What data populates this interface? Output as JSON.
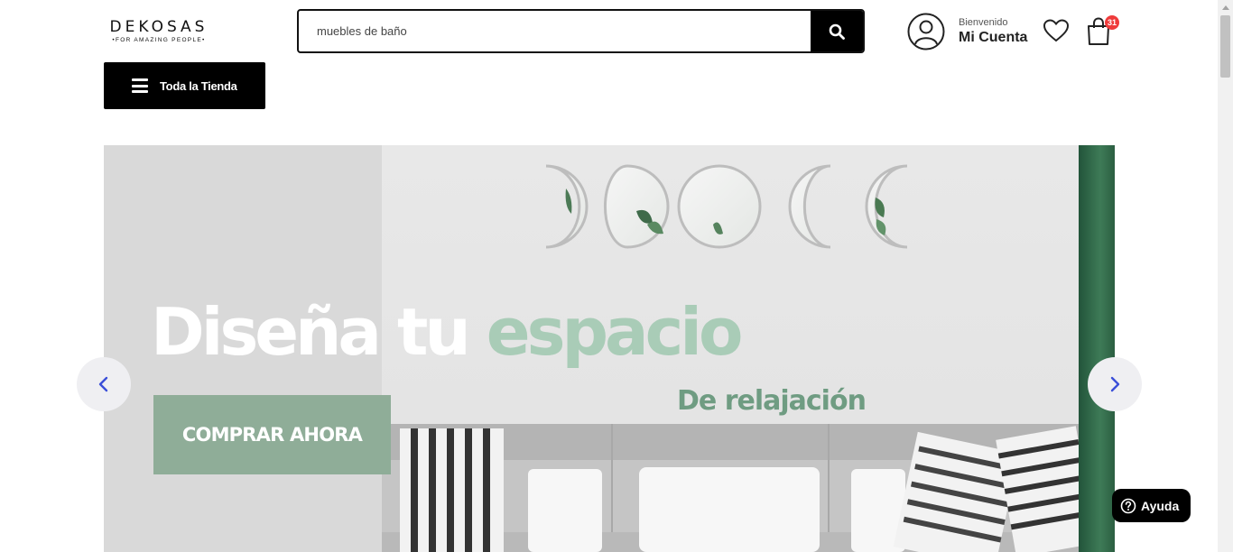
{
  "header": {
    "logo": {
      "name": "DEKOSAS",
      "tagline": "•FOR AMAZING PEOPLE•"
    },
    "search": {
      "value": "muebles de baño",
      "icon": "search-icon"
    },
    "account": {
      "welcome": "Bienvenido",
      "label": "Mi Cuenta",
      "icon": "user-circle-icon"
    },
    "wishlist": {
      "icon": "heart-icon"
    },
    "cart": {
      "icon": "shopping-bag-icon",
      "count": "31"
    }
  },
  "nav": {
    "store_button": "Toda la Tienda",
    "icon": "hamburger-menu-icon"
  },
  "banner": {
    "headline_white": "Diseña tu ",
    "headline_tint": "espacio",
    "subline": "De relajación",
    "cta": "COMPRAR AHORA",
    "prev_icon": "chevron-left-icon",
    "next_icon": "chevron-right-icon"
  },
  "help": {
    "label": "Ayuda",
    "icon": "question-circle-icon"
  },
  "colors": {
    "accent": "#000000",
    "badge": "#ef3b3b",
    "banner_green": "#2f6547",
    "cta": "#8fad98",
    "tint_text": "#a9ccb7",
    "arrow": "#3b4fd8"
  }
}
